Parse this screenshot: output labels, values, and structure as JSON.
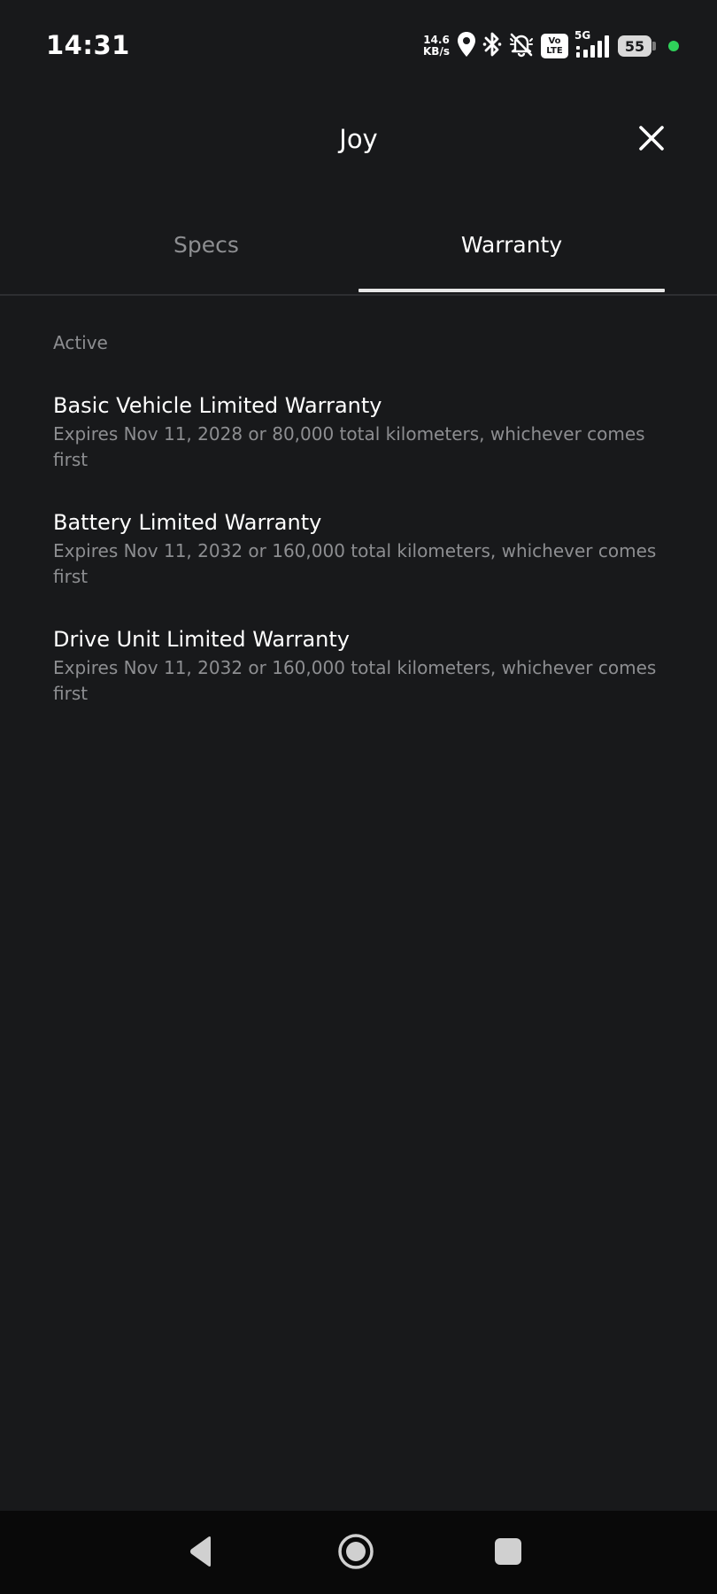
{
  "status_bar": {
    "time": "14:31",
    "net_speed_value": "14.6",
    "net_speed_unit": "KB/s",
    "volte_top": "Vo",
    "volte_bottom": "LTE",
    "network_type": "5G",
    "battery_level": "55",
    "icons": [
      "location-icon",
      "bluetooth-icon",
      "bell-off-icon",
      "volte-icon",
      "signal-icon",
      "battery-icon",
      "privacy-dot-icon"
    ],
    "colors": {
      "privacy_dot": "#2fd15a"
    }
  },
  "header": {
    "title": "Joy",
    "close_icon": "close-icon"
  },
  "tabs": [
    {
      "label": "Specs",
      "active": false
    },
    {
      "label": "Warranty",
      "active": true
    }
  ],
  "warranty": {
    "section_label": "Active",
    "items": [
      {
        "title": "Basic Vehicle Limited Warranty",
        "description": "Expires Nov 11, 2028 or 80,000 total kilometers, whichever comes first"
      },
      {
        "title": "Battery Limited Warranty",
        "description": "Expires Nov 11, 2032 or 160,000 total kilometers, whichever comes first"
      },
      {
        "title": "Drive Unit Limited Warranty",
        "description": "Expires Nov 11, 2032 or 160,000 total kilometers, whichever comes first"
      }
    ]
  },
  "nav_bar": {
    "icons": [
      "back-icon",
      "home-icon",
      "recents-icon"
    ]
  },
  "colors": {
    "background": "#18191b",
    "primary_text": "#ffffff",
    "secondary_text": "#8d8e91",
    "nav_bar": "#090909"
  }
}
